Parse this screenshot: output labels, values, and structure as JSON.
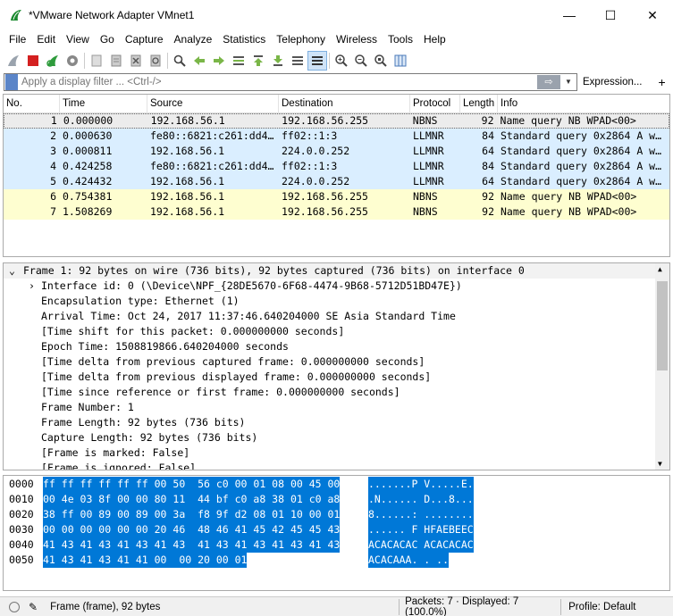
{
  "window": {
    "title": "*VMware Network Adapter VMnet1",
    "minimize_glyph": "—",
    "maximize_glyph": "☐",
    "close_glyph": "✕"
  },
  "menu": [
    "File",
    "Edit",
    "View",
    "Go",
    "Capture",
    "Analyze",
    "Statistics",
    "Telephony",
    "Wireless",
    "Tools",
    "Help"
  ],
  "toolbar": {
    "icons": [
      "shark-fin-icon",
      "stop-capture-icon",
      "restart-capture-icon",
      "capture-options-icon",
      "open-file-icon",
      "save-file-icon",
      "close-file-icon",
      "reload-file-icon",
      "find-packet-icon",
      "go-back-icon",
      "go-forward-icon",
      "go-to-packet-icon",
      "go-first-icon",
      "go-last-icon",
      "auto-scroll-icon",
      "colorize-icon",
      "zoom-in-icon",
      "zoom-out-icon",
      "zoom-normal-icon",
      "resize-columns-icon"
    ]
  },
  "filter": {
    "placeholder": "Apply a display filter ... <Ctrl-/>",
    "apply_glyph": "⇨",
    "dropdown_glyph": "▼",
    "expression_label": "Expression...",
    "add_label": "+"
  },
  "packet_list": {
    "columns": [
      "No.",
      "Time",
      "Source",
      "Destination",
      "Protocol",
      "Length",
      "Info"
    ],
    "rows": [
      {
        "no": "1",
        "time": "0.000000",
        "source": "192.168.56.1",
        "destination": "192.168.56.255",
        "protocol": "NBNS",
        "length": "92",
        "info": "Name query NB WPAD<00>"
      },
      {
        "no": "2",
        "time": "0.000630",
        "source": "fe80::6821:c261:dd4…",
        "destination": "ff02::1:3",
        "protocol": "LLMNR",
        "length": "84",
        "info": "Standard query 0x2864 A w…"
      },
      {
        "no": "3",
        "time": "0.000811",
        "source": "192.168.56.1",
        "destination": "224.0.0.252",
        "protocol": "LLMNR",
        "length": "64",
        "info": "Standard query 0x2864 A w…"
      },
      {
        "no": "4",
        "time": "0.424258",
        "source": "fe80::6821:c261:dd4…",
        "destination": "ff02::1:3",
        "protocol": "LLMNR",
        "length": "84",
        "info": "Standard query 0x2864 A w…"
      },
      {
        "no": "5",
        "time": "0.424432",
        "source": "192.168.56.1",
        "destination": "224.0.0.252",
        "protocol": "LLMNR",
        "length": "64",
        "info": "Standard query 0x2864 A w…"
      },
      {
        "no": "6",
        "time": "0.754381",
        "source": "192.168.56.1",
        "destination": "192.168.56.255",
        "protocol": "NBNS",
        "length": "92",
        "info": "Name query NB WPAD<00>"
      },
      {
        "no": "7",
        "time": "1.508269",
        "source": "192.168.56.1",
        "destination": "192.168.56.255",
        "protocol": "NBNS",
        "length": "92",
        "info": "Name query NB WPAD<00>"
      }
    ]
  },
  "details": {
    "top": "Frame 1: 92 bytes on wire (736 bits), 92 bytes captured (736 bits) on interface 0",
    "lines": [
      "Interface id: 0 (\\Device\\NPF_{28DE5670-6F68-4474-9B68-5712D51BD47E})",
      "Encapsulation type: Ethernet (1)",
      "Arrival Time: Oct 24, 2017 11:37:46.640204000 SE Asia Standard Time",
      "[Time shift for this packet: 0.000000000 seconds]",
      "Epoch Time: 1508819866.640204000 seconds",
      "[Time delta from previous captured frame: 0.000000000 seconds]",
      "[Time delta from previous displayed frame: 0.000000000 seconds]",
      "[Time since reference or first frame: 0.000000000 seconds]",
      "Frame Number: 1",
      "Frame Length: 92 bytes (736 bits)",
      "Capture Length: 92 bytes (736 bits)",
      "[Frame is marked: False]",
      "[Frame is ignored: False]"
    ]
  },
  "bytes": [
    {
      "offset": "0000",
      "hex": "ff ff ff ff ff ff 00 50  56 c0 00 01 08 00 45 00",
      "ascii": ".......P V.....E."
    },
    {
      "offset": "0010",
      "hex": "00 4e 03 8f 00 00 80 11  44 bf c0 a8 38 01 c0 a8",
      "ascii": ".N...... D...8..."
    },
    {
      "offset": "0020",
      "hex": "38 ff 00 89 00 89 00 3a  f8 9f d2 08 01 10 00 01",
      "ascii": "8......: ........"
    },
    {
      "offset": "0030",
      "hex": "00 00 00 00 00 00 20 46  48 46 41 45 42 45 45 43",
      "ascii": "...... F HFAEBEEC"
    },
    {
      "offset": "0040",
      "hex": "41 43 41 43 41 43 41 43  41 43 41 43 41 43 41 43",
      "ascii": "ACACACAC ACACACAC"
    },
    {
      "offset": "0050",
      "hex": "41 43 41 43 41 41 00  00 20 00 01",
      "ascii": "ACACAAA. . .."
    }
  ],
  "status": {
    "frame_label": "Frame (frame), 92 bytes",
    "packets_label": "Packets: 7 · Displayed: 7 (100.0%)",
    "profile_label": "Profile: Default"
  }
}
